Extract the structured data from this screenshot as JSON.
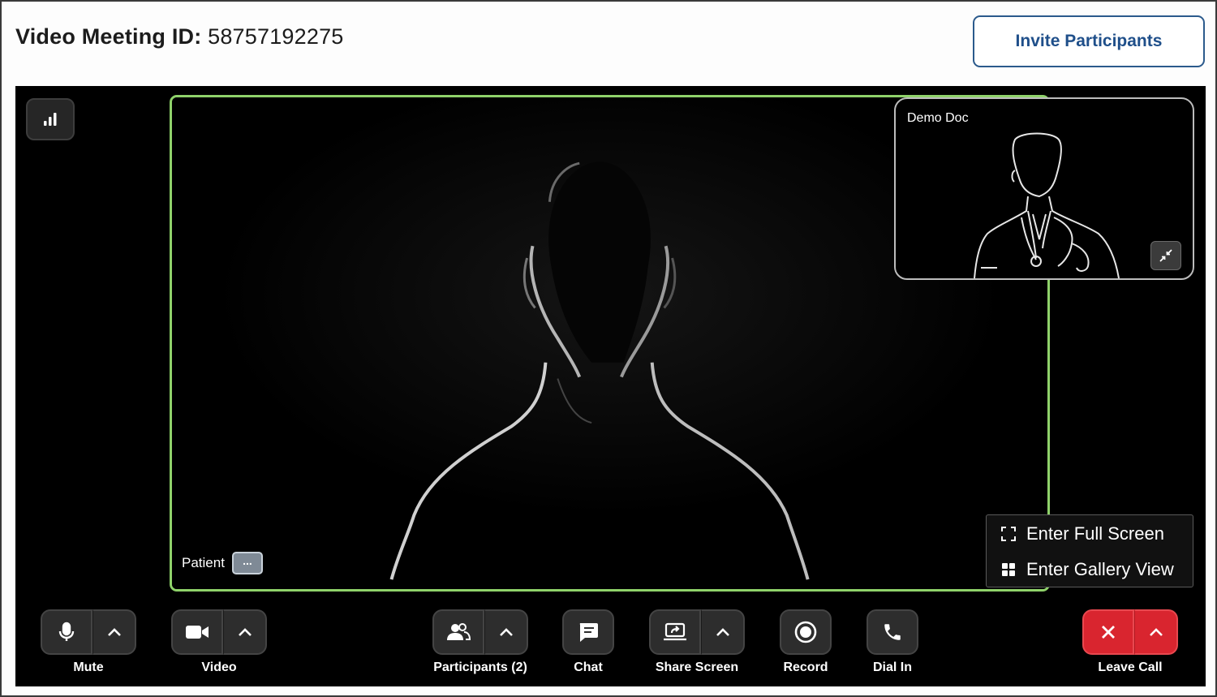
{
  "header": {
    "meeting_label": "Video Meeting ID:",
    "meeting_id": "58757192275",
    "invite_label": "Invite Participants"
  },
  "stage": {
    "main_participant": "Patient",
    "self_view_name": "Demo Doc",
    "view_menu": {
      "full_screen_label": "Enter Full Screen",
      "gallery_label": "Enter Gallery View"
    }
  },
  "controls": {
    "mute": "Mute",
    "video": "Video",
    "participants": "Participants (2)",
    "chat": "Chat",
    "share_screen": "Share Screen",
    "record": "Record",
    "dial_in": "Dial In",
    "leave_call": "Leave Call"
  },
  "colors": {
    "active_speaker_border": "#8fd26a",
    "invite_accent": "#1f4f8a",
    "leave_red": "#d9252f"
  },
  "icons": [
    "signal-strength-icon",
    "more-options-icon",
    "minimize-icon",
    "fullscreen-icon",
    "gallery-grid-icon",
    "microphone-icon",
    "camera-icon",
    "participants-icon",
    "chat-icon",
    "share-screen-icon",
    "record-icon",
    "phone-icon",
    "close-icon",
    "chevron-up-icon"
  ]
}
